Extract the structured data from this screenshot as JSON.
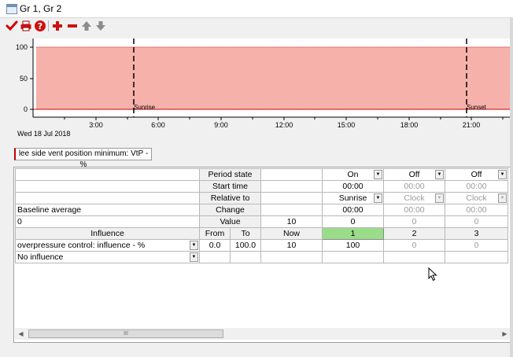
{
  "window": {
    "title": "Gr 1, Gr 2"
  },
  "toolbar": {
    "icons": [
      "check-icon",
      "print-icon",
      "help-icon",
      "add-icon",
      "remove-icon",
      "move-up-icon",
      "move-down-icon"
    ]
  },
  "chart": {
    "y_ticks": [
      "100",
      "50",
      "0"
    ],
    "x_ticks": [
      "3:00",
      "6:00",
      "9:00",
      "12:00",
      "15:00",
      "18:00",
      "21:00"
    ],
    "date_label": "Wed 18 Jul 2018",
    "markers": {
      "sunrise": "Sunrise",
      "sunset": "Sunset"
    },
    "colors": {
      "fill": "#f7b6b0",
      "line": "#d00000"
    }
  },
  "chart_data": {
    "type": "area",
    "xlabel": "",
    "ylabel": "",
    "ylim": [
      0,
      100
    ],
    "x_tick_labels": [
      "3:00",
      "6:00",
      "9:00",
      "12:00",
      "15:00",
      "18:00",
      "21:00"
    ],
    "series": [
      {
        "x": [
          "0:00",
          "23:59"
        ],
        "values": [
          100,
          100
        ]
      }
    ],
    "annotations": [
      "Sunrise",
      "Sunset"
    ],
    "grid": true
  },
  "tab": {
    "label": "lee side vent position minimum: VtP - %"
  },
  "grid": {
    "row_period_state": {
      "label": "Period state",
      "cells": [
        {
          "value": "On",
          "dropdown": true,
          "disabled": false
        },
        {
          "value": "Off",
          "dropdown": true,
          "disabled": false
        },
        {
          "value": "Off",
          "dropdown": true,
          "disabled": false
        }
      ]
    },
    "row_start_time": {
      "label": "Start time",
      "cells": [
        {
          "value": "00:00"
        },
        {
          "value": "00:00",
          "disabled": true
        },
        {
          "value": "00:00",
          "disabled": true
        }
      ]
    },
    "row_relative_to": {
      "label": "Relative to",
      "cells": [
        {
          "value": "Sunrise",
          "dropdown": true
        },
        {
          "value": "Clock",
          "dropdown": true,
          "disabled": true
        },
        {
          "value": "Clock",
          "dropdown": true,
          "disabled": true
        }
      ]
    },
    "row_change": {
      "left": "Baseline average",
      "label": "Change",
      "cells": [
        {
          "value": "00:00"
        },
        {
          "value": "00:00",
          "disabled": true
        },
        {
          "value": "00:00",
          "disabled": true
        }
      ]
    },
    "row_value": {
      "left": "0",
      "label": "Value",
      "now": "10",
      "cells": [
        {
          "value": "0"
        },
        {
          "value": "0",
          "disabled": true
        },
        {
          "value": "0",
          "disabled": true
        }
      ]
    },
    "header": {
      "influence": "Influence",
      "from": "From",
      "to": "To",
      "now": "Now",
      "periods": [
        "1",
        "2",
        "3"
      ]
    },
    "influence_rows": [
      {
        "name": "overpressure control: influence - %",
        "from": "0.0",
        "to": "100.0",
        "now": "10",
        "values": [
          "100",
          "0",
          "0"
        ]
      },
      {
        "name": "No influence",
        "from": "",
        "to": "",
        "now": "",
        "values": [
          "",
          "",
          ""
        ]
      }
    ]
  },
  "scrollbar": {
    "thumb_grip": "III"
  }
}
